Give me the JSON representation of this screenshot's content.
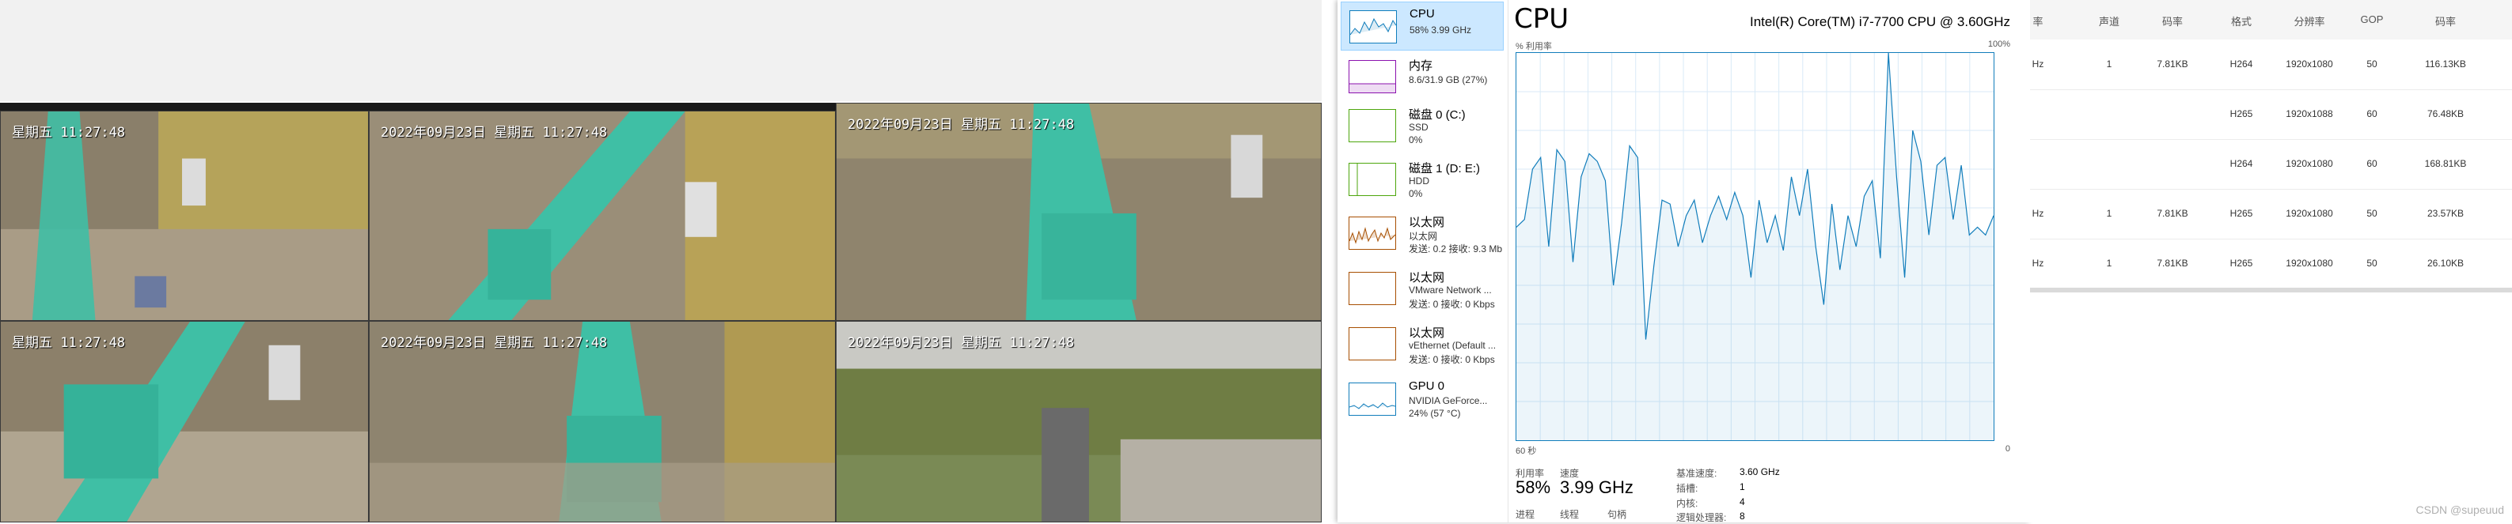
{
  "cameras": {
    "tiles": [
      {
        "timestamp": "星期五 11:27:48"
      },
      {
        "timestamp": "2022年09月23日 星期五 11:27:48"
      },
      {
        "timestamp": "2022年09月23日 星期五 11:27:48"
      },
      {
        "timestamp": "星期五 11:27:48"
      },
      {
        "timestamp": "2022年09月23日 星期五 11:27:48"
      },
      {
        "timestamp": "2022年09月23日 星期五 11:27:48"
      }
    ]
  },
  "task_manager": {
    "sidebar": [
      {
        "name": "CPU",
        "sub1": "58% 3.99 GHz",
        "sub2": "",
        "sub3": "",
        "color": "#117dbb",
        "selected": true
      },
      {
        "name": "内存",
        "sub1": "8.6/31.9 GB (27%)",
        "sub2": "",
        "sub3": "",
        "color": "#8b12ae"
      },
      {
        "name": "磁盘 0 (C:)",
        "sub1": "SSD",
        "sub2": "0%",
        "sub3": "",
        "color": "#4da60c"
      },
      {
        "name": "磁盘 1 (D: E:)",
        "sub1": "HDD",
        "sub2": "0%",
        "sub3": "",
        "color": "#4da60c"
      },
      {
        "name": "以太网",
        "sub1": "以太网",
        "sub2": "发送: 0.2 接收: 9.3 Mb",
        "sub3": "",
        "color": "#a74f01"
      },
      {
        "name": "以太网",
        "sub1": "VMware Network ...",
        "sub2": "发送: 0 接收: 0 Kbps",
        "sub3": "",
        "color": "#a74f01"
      },
      {
        "name": "以太网",
        "sub1": "vEthernet (Default ...",
        "sub2": "发送: 0 接收: 0 Kbps",
        "sub3": "",
        "color": "#a74f01"
      },
      {
        "name": "GPU 0",
        "sub1": "NVIDIA GeForce...",
        "sub2": "24% (57 °C)",
        "sub3": "",
        "color": "#117dbb"
      }
    ],
    "title": "CPU",
    "model": "Intel(R) Core(TM) i7-7700 CPU @ 3.60GHz",
    "graph_label_left": "% 利用率",
    "graph_label_right": "100%",
    "axis_left": "60 秒",
    "axis_right": "0",
    "stats": {
      "util_label": "利用率",
      "util_value": "58%",
      "speed_label": "速度",
      "speed_value": "3.99 GHz",
      "process_label": "进程",
      "thread_label": "线程",
      "handle_label": "句柄",
      "base_speed_label": "基准速度:",
      "base_speed_value": "3.60 GHz",
      "sockets_label": "插槽:",
      "sockets_value": "1",
      "cores_label": "内核:",
      "cores_value": "4",
      "logical_label": "逻辑处理器:",
      "logical_value": "8"
    },
    "cpu_series": {
      "name": "",
      "values": [
        55,
        57,
        70,
        73,
        50,
        75,
        72,
        46,
        68,
        74,
        72,
        67,
        40,
        56,
        76,
        73,
        26,
        45,
        62,
        61,
        50,
        58,
        62,
        51,
        58,
        63,
        57,
        64,
        58,
        42,
        62,
        51,
        58,
        49,
        68,
        58,
        70,
        50,
        35,
        61,
        44,
        58,
        50,
        63,
        67,
        47,
        100,
        68,
        42,
        80,
        72,
        53,
        71,
        73,
        57,
        71,
        53,
        55,
        53,
        58
      ]
    }
  },
  "table": {
    "headers": [
      "率",
      "声道",
      "码率",
      "格式",
      "分辨率",
      "GOP",
      "码率"
    ],
    "rows": [
      [
        "Hz",
        "1",
        "7.81KB",
        "H264",
        "1920x1080",
        "50",
        "116.13KB"
      ],
      [
        "",
        "",
        "",
        "H265",
        "1920x1088",
        "60",
        "76.48KB"
      ],
      [
        "",
        "",
        "",
        "H264",
        "1920x1080",
        "60",
        "168.81KB"
      ],
      [
        "Hz",
        "1",
        "7.81KB",
        "H265",
        "1920x1080",
        "50",
        "23.57KB"
      ],
      [
        "Hz",
        "1",
        "7.81KB",
        "H265",
        "1920x1080",
        "50",
        "26.10KB"
      ]
    ]
  },
  "watermark": "CSDN @supeuud"
}
